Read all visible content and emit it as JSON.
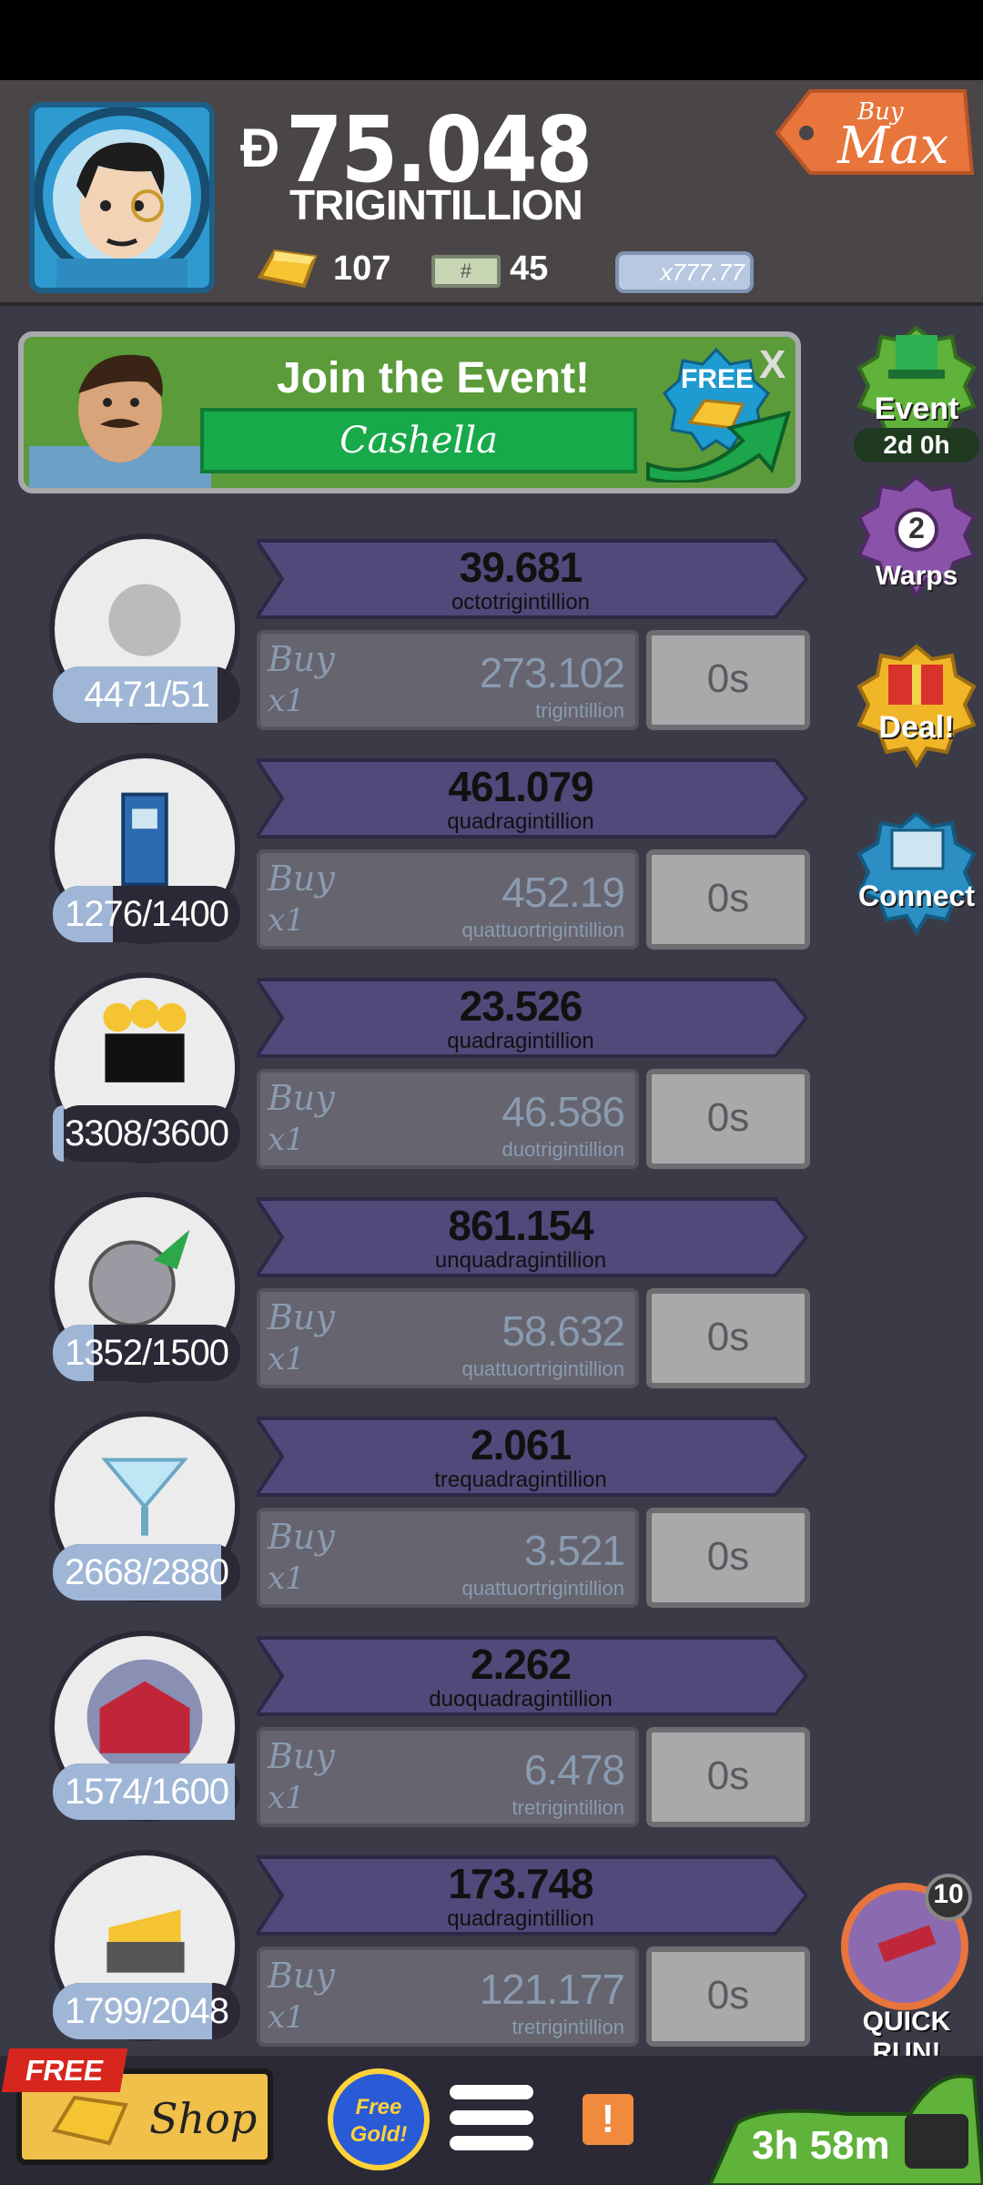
{
  "header": {
    "currency_symbol": "Đ",
    "money_value": "75.048",
    "money_unit": "TRIGINTILLION",
    "gold_count": "107",
    "megabucks_count": "45",
    "multiplier": "x777.77",
    "buy_max_small": "Buy",
    "buy_max_big": "Max"
  },
  "event_banner": {
    "title": "Join the Event!",
    "event_name": "Cashella",
    "free_label": "FREE",
    "close": "X"
  },
  "side": {
    "event_label": "Event",
    "event_time": "2d 0h",
    "warps_count": "2",
    "warps_label": "Warps",
    "deal_label": "Deal!",
    "connect_label": "Connect",
    "quickrun_count": "10",
    "quickrun_label": "QUICK RUN!"
  },
  "businesses": [
    {
      "icon": "coin-stack-icon",
      "count": "4471/51",
      "progress": 0.88,
      "profit": "39.681",
      "profit_unit": "octotrigintillion",
      "buy": "Buy",
      "qty": "x1",
      "cost": "273.102",
      "cost_unit": "trigintillion",
      "time": "0s"
    },
    {
      "icon": "police-box-icon",
      "count": "1276/1400",
      "progress": 0.32,
      "profit": "461.079",
      "profit_unit": "quadragintillion",
      "buy": "Buy",
      "qty": "x1",
      "cost": "452.19",
      "cost_unit": "quattuortrigintillion",
      "time": "0s"
    },
    {
      "icon": "podium-trio-icon",
      "count": "3308/3600",
      "progress": 0.06,
      "profit": "23.526",
      "profit_unit": "quadragintillion",
      "buy": "Buy",
      "qty": "x1",
      "cost": "46.586",
      "cost_unit": "duotrigintillion",
      "time": "0s"
    },
    {
      "icon": "moon-rocket-icon",
      "count": "1352/1500",
      "progress": 0.22,
      "profit": "861.154",
      "profit_unit": "unquadragintillion",
      "buy": "Buy",
      "qty": "x1",
      "cost": "58.632",
      "cost_unit": "quattuortrigintillion",
      "time": "0s"
    },
    {
      "icon": "cocktail-glass-icon",
      "count": "2668/2880",
      "progress": 0.9,
      "profit": "2.061",
      "profit_unit": "trequadragintillion",
      "buy": "Buy",
      "qty": "x1",
      "cost": "3.521",
      "cost_unit": "quattuortrigintillion",
      "time": "0s"
    },
    {
      "icon": "barn-icon",
      "count": "1574/1600",
      "progress": 0.97,
      "profit": "2.262",
      "profit_unit": "duoquadragintillion",
      "buy": "Buy",
      "qty": "x1",
      "cost": "6.478",
      "cost_unit": "tretrigintillion",
      "time": "0s"
    },
    {
      "icon": "cheese-cart-icon",
      "count": "1799/2048",
      "progress": 0.85,
      "profit": "173.748",
      "profit_unit": "quadragintillion",
      "buy": "Buy",
      "qty": "x1",
      "cost": "121.177",
      "cost_unit": "tretrigintillion",
      "time": "0s"
    }
  ],
  "bottom": {
    "free_tag": "FREE",
    "shop_label": "Shop",
    "free_gold_line1": "Free",
    "free_gold_line2": "Gold!",
    "alert": "!",
    "timer": "3h 58m"
  },
  "colors": {
    "background": "#3b3b48",
    "profit_bar": "#4f4a7a",
    "event_green": "#17a94a",
    "gold": "#f5c432"
  }
}
